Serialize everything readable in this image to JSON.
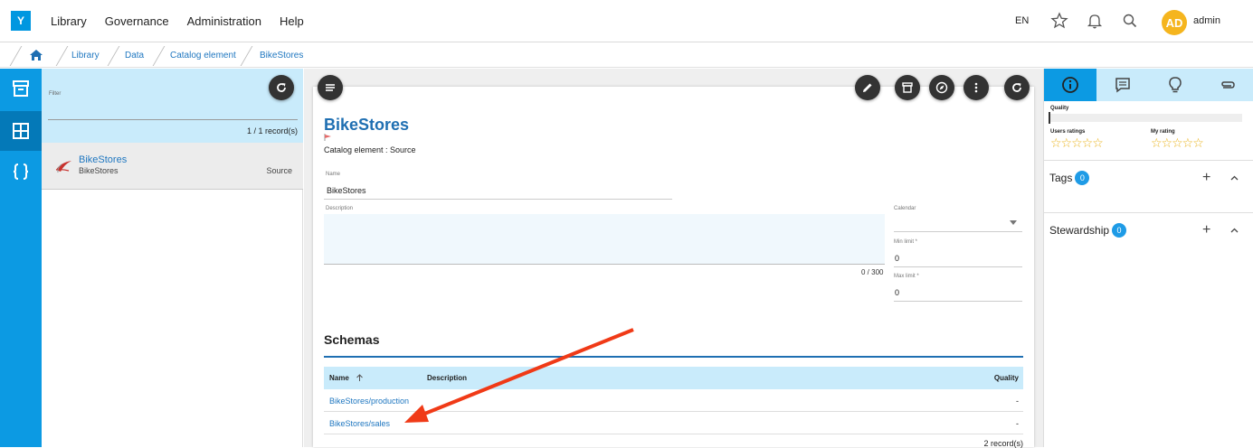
{
  "topbar": {
    "logo": "Y",
    "menu": [
      "Library",
      "Governance",
      "Administration",
      "Help"
    ],
    "language": "EN",
    "avatar_initials": "AD",
    "username": "admin",
    "avatar_color": "#f5b51e"
  },
  "breadcrumb": [
    "Library",
    "Data",
    "Catalog element",
    "BikeStores"
  ],
  "left_panel": {
    "filter_label": "Filter",
    "records": "1 / 1 record(s)",
    "items": [
      {
        "title": "BikeStores",
        "subtitle": "BikeStores",
        "type": "Source"
      }
    ]
  },
  "detail": {
    "title": "BikeStores",
    "subtitle": "Catalog element : Source",
    "name_label": "Name",
    "name_value": "BikeStores",
    "description_label": "Description",
    "description_counter": "0 / 300",
    "calendar_label": "Calendar",
    "min_limit_label": "Min limit *",
    "min_limit_value": "0",
    "max_limit_label": "Max limit *",
    "max_limit_value": "0",
    "schemas_heading": "Schemas",
    "table_headers": {
      "name": "Name",
      "description": "Description",
      "quality": "Quality"
    },
    "rows": [
      {
        "name": "BikeStores/production",
        "quality": "-"
      },
      {
        "name": "BikeStores/sales",
        "quality": "-"
      }
    ],
    "total": "2 record(s)"
  },
  "right_panel": {
    "quality_label": "Quality",
    "users_ratings_label": "Users ratings",
    "my_rating_label": "My rating",
    "users_rating_stars": 0,
    "my_rating_stars": 0,
    "tags_label": "Tags",
    "tags_count": "0",
    "stewardship_label": "Stewardship",
    "stewardship_count": "0"
  },
  "colors": {
    "accent": "#0c9ae3",
    "link": "#1f77c0",
    "highlight": "#c9ebfb",
    "annotation_arrow": "#f03a17"
  }
}
